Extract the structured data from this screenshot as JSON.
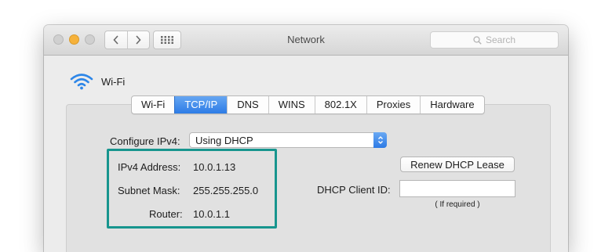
{
  "window": {
    "title": "Network"
  },
  "titlebar": {
    "close_icon": "close-button",
    "minimize_icon": "minimize-button",
    "zoom_icon": "zoom-button",
    "back_icon": "chevron-left-icon",
    "forward_icon": "chevron-right-icon",
    "show_all_icon": "grid-icon"
  },
  "search": {
    "placeholder": "Search",
    "icon": "search-icon"
  },
  "interface": {
    "name": "Wi-Fi",
    "icon": "wifi-icon"
  },
  "tabs": [
    {
      "label": "Wi-Fi",
      "selected": false
    },
    {
      "label": "TCP/IP",
      "selected": true
    },
    {
      "label": "DNS",
      "selected": false
    },
    {
      "label": "WINS",
      "selected": false
    },
    {
      "label": "802.1X",
      "selected": false
    },
    {
      "label": "Proxies",
      "selected": false
    },
    {
      "label": "Hardware",
      "selected": false
    }
  ],
  "tcpip": {
    "configure_label": "Configure IPv4:",
    "configure_value": "Using DHCP",
    "ipv4_label": "IPv4 Address:",
    "ipv4_value": "10.0.1.13",
    "subnet_label": "Subnet Mask:",
    "subnet_value": "255.255.255.0",
    "router_label": "Router:",
    "router_value": "10.0.1.1",
    "renew_button": "Renew DHCP Lease",
    "client_id_label": "DHCP Client ID:",
    "client_id_value": "",
    "client_id_hint": "( If required )"
  },
  "colors": {
    "accent_blue": "#2d7ce6",
    "highlight_teal": "#17958e",
    "minimize_yellow": "#f6b23b"
  }
}
